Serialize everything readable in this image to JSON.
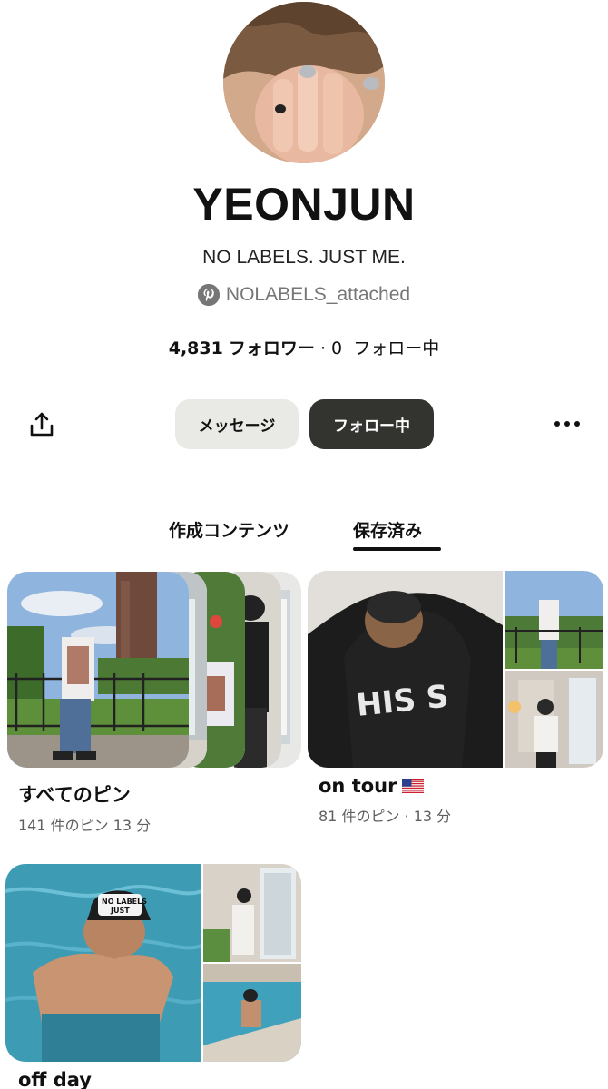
{
  "profile": {
    "name": "YEONJUN",
    "bio": "NO LABELS. JUST ME.",
    "handle": "NOLABELS_attached",
    "followers_count": "4,831",
    "followers_label": "フォロワー",
    "separator": "·",
    "following_count": "0",
    "following_label": "フォロー中"
  },
  "actions": {
    "message_label": "メッセージ",
    "follow_label": "フォロー中"
  },
  "tabs": [
    {
      "label": "作成コンテンツ",
      "active": false
    },
    {
      "label": "保存済み",
      "active": true
    }
  ],
  "boards": [
    {
      "title": "すべてのピン",
      "meta": "141 件のピン 13 分"
    },
    {
      "title": "on tour",
      "title_emoji": "us-flag",
      "meta": "81 件のピン · 13 分"
    },
    {
      "title": "off day"
    }
  ],
  "icons": {
    "share": "share-icon",
    "more": "more-icon",
    "pinterest": "pinterest-logo-icon"
  },
  "colors": {
    "follow_button": "#333330",
    "message_button": "#e9e9e5",
    "muted_text": "#767676"
  }
}
